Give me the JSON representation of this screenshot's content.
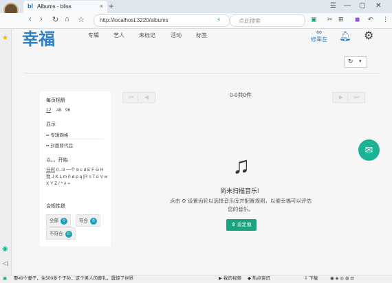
{
  "browser": {
    "tab_title": "Albums - bliss",
    "tab_favicon": "bl",
    "url": "http://localhost:3220/albums",
    "search_placeholder": "点此搜索"
  },
  "app": {
    "logo": "幸福",
    "nav": [
      "专辑",
      "艺人",
      "未标记",
      "活动",
      "标签"
    ],
    "user_name": "修辈左",
    "user_icon": "∞"
  },
  "panel": {
    "per_page_title": "每页相册",
    "per_page_options": [
      "12",
      "48",
      "96"
    ],
    "display_title": "显示",
    "display_options": [
      "专辑网格",
      "封面替代品"
    ],
    "starts_with_title": "以。。开始",
    "letters": [
      "任何",
      "0...9",
      "一个",
      "b",
      "c",
      "d",
      "E",
      "F",
      "G",
      "H",
      "我",
      "J",
      "K",
      "L",
      "m",
      "ñ",
      "ø",
      "p",
      "q",
      "[R",
      "s",
      "T",
      "ü",
      "V",
      "w",
      "X",
      "Y",
      "Z",
      "/",
      "*",
      "#",
      "="
    ],
    "compliance_title": "合规性是",
    "compliance_buttons": [
      {
        "label": "全部",
        "count": "0"
      },
      {
        "label": "符合",
        "count": "0"
      },
      {
        "label": "不符合",
        "count": "0"
      }
    ]
  },
  "main": {
    "count_text": "0-0共0件",
    "empty_title": "尚未扫描音乐!",
    "empty_desc_prefix": "点击",
    "empty_desc": "设置齿轮以选择音乐库并配置规则，以便幸福可以评估您的音乐。",
    "settings_button": "设定值"
  },
  "statusbar": {
    "news": "娶49个妻子，生500多个子孙，这个男人的葬礼，震惊了世界",
    "items": [
      "我的视频",
      "热点资讯",
      "下载"
    ]
  },
  "colors": {
    "primary": "#2d7fc5",
    "accent": "#1ab394",
    "badge": "#17a2b8"
  }
}
